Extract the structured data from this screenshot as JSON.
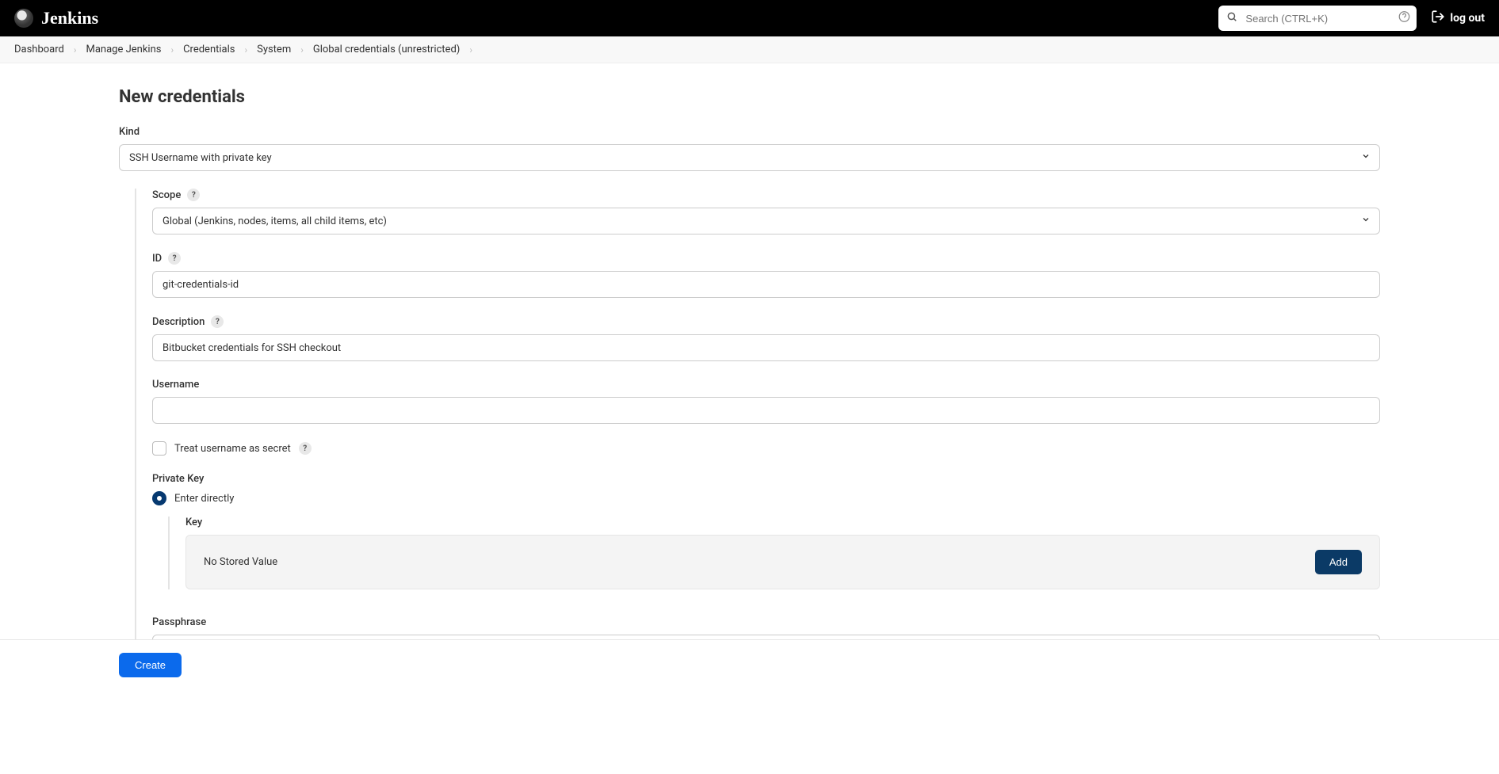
{
  "header": {
    "brand": "Jenkins",
    "search_placeholder": "Search (CTRL+K)",
    "logout_label": "log out"
  },
  "breadcrumbs": [
    "Dashboard",
    "Manage Jenkins",
    "Credentials",
    "System",
    "Global credentials (unrestricted)"
  ],
  "page": {
    "title": "New credentials"
  },
  "form": {
    "kind": {
      "label": "Kind",
      "value": "SSH Username with private key"
    },
    "scope": {
      "label": "Scope",
      "value": "Global (Jenkins, nodes, items, all child items, etc)"
    },
    "id": {
      "label": "ID",
      "value": "git-credentials-id"
    },
    "description": {
      "label": "Description",
      "value": "Bitbucket credentials for SSH checkout"
    },
    "username": {
      "label": "Username",
      "value": ""
    },
    "treat_secret": {
      "label": "Treat username as secret",
      "checked": false
    },
    "private_key": {
      "label": "Private Key",
      "option_label": "Enter directly",
      "key_label": "Key",
      "no_value_text": "No Stored Value",
      "add_label": "Add"
    },
    "passphrase": {
      "label": "Passphrase",
      "value": ""
    }
  },
  "footer": {
    "create_label": "Create"
  }
}
